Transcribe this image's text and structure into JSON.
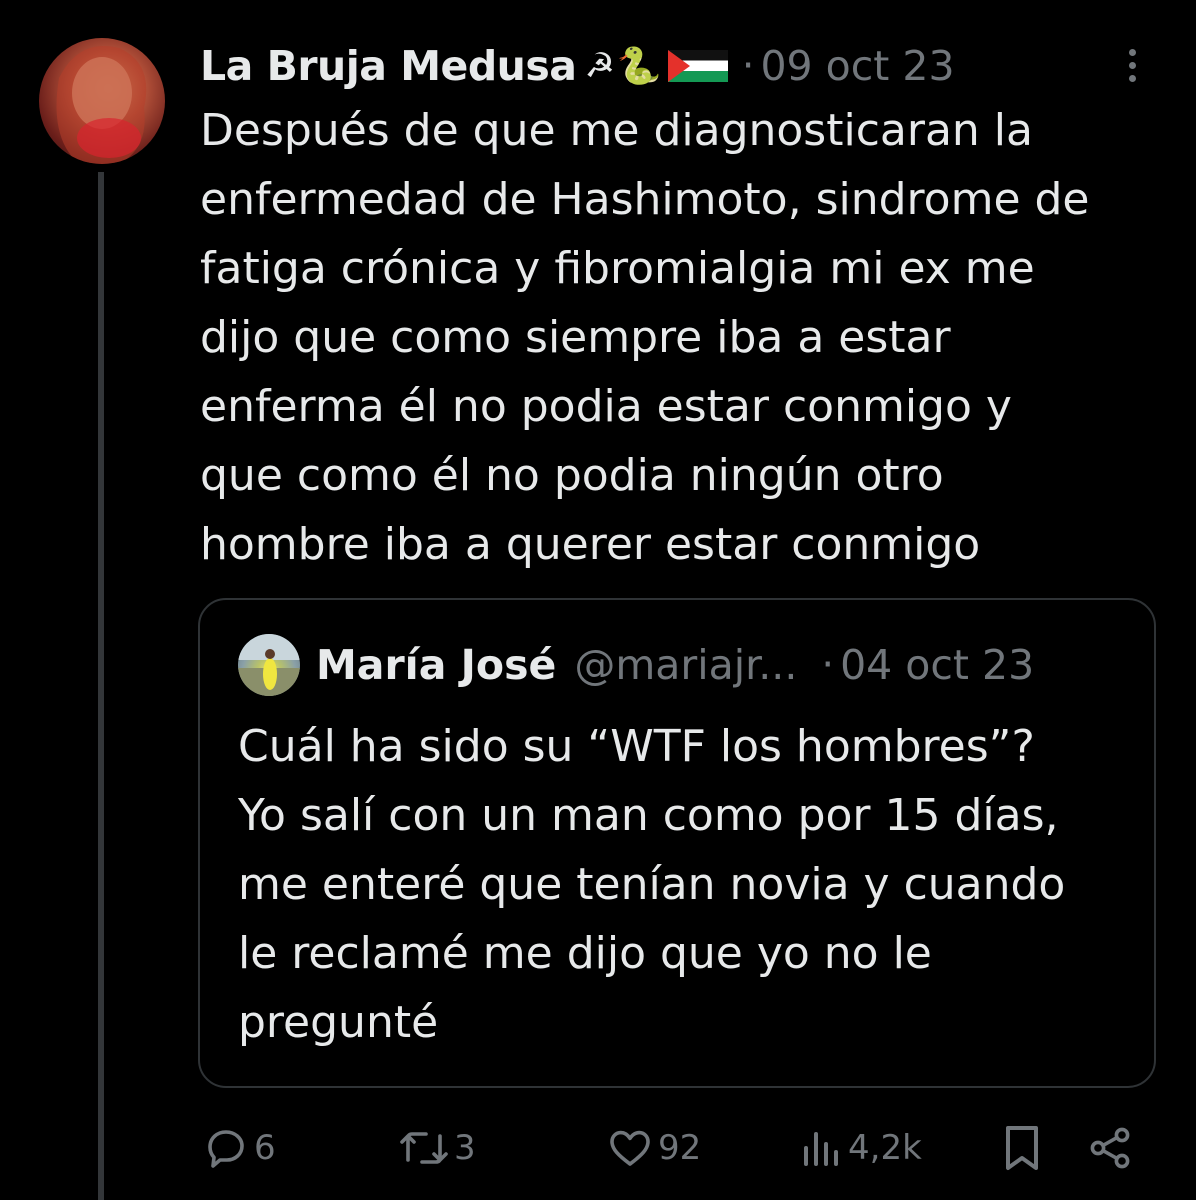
{
  "tweet": {
    "author_name": "La Bruja Medusa",
    "author_emojis": [
      "☭",
      "🐍"
    ],
    "separator": "·",
    "date": "09 oct 23",
    "text_lines": [
      "Después de que me diagnosticaran la",
      "enfermedad de Hashimoto, sindrome de",
      "fatiga crónica y fibromialgia mi ex me",
      "dijo que como siempre iba a estar",
      "enferma él no podia estar conmigo y",
      "que como él no podia ningún otro",
      "hombre iba a querer estar conmigo"
    ]
  },
  "quote": {
    "author_name": "María José",
    "handle": "@mariajr...",
    "separator": "·",
    "date": "04 oct 23",
    "text_lines": [
      "Cuál ha sido su “WTF los hombres”?",
      "Yo salí con un man como por 15 días,",
      "me enteré que tenían novia y cuando",
      "le reclamé me dijo que yo no le",
      "pregunté"
    ]
  },
  "actions": {
    "replies": "6",
    "retweets": "3",
    "likes": "92",
    "views": "4,2k"
  },
  "icons": {
    "more": "more-vertical-icon",
    "reply": "reply-icon",
    "retweet": "retweet-icon",
    "like": "heart-icon",
    "views": "views-icon",
    "bookmark": "bookmark-icon",
    "share": "share-icon",
    "flag": "palestine-flag-icon"
  },
  "colors": {
    "background": "#000000",
    "text": "#e7e9ea",
    "muted": "#71767b",
    "border": "#2f3336"
  }
}
